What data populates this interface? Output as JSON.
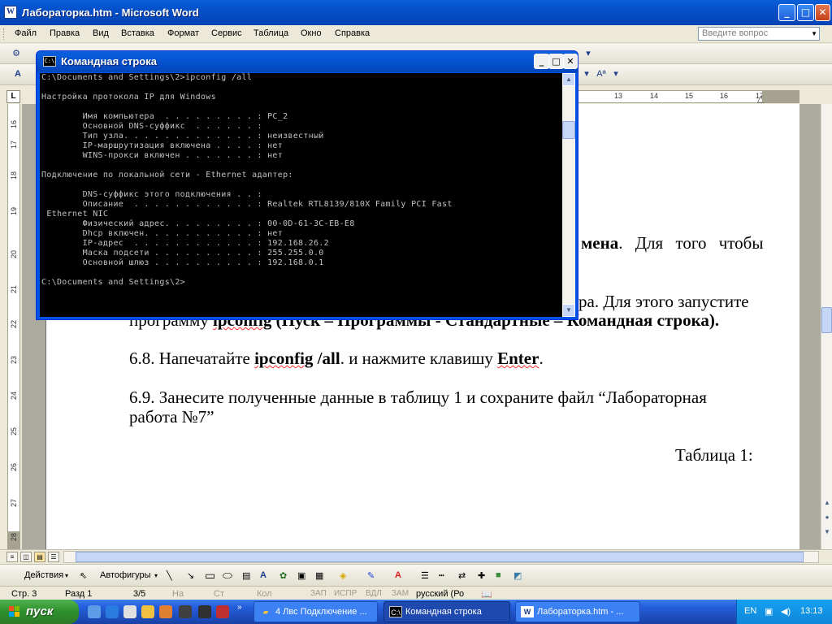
{
  "word": {
    "title": "Лабораторка.htm - Microsoft Word",
    "app_icon": "W",
    "menu": [
      "Файл",
      "Правка",
      "Вид",
      "Вставка",
      "Формат",
      "Сервис",
      "Таблица",
      "Окно",
      "Справка"
    ],
    "ask_placeholder": "Введите вопрос",
    "ruler_numbers": [
      "13",
      "14",
      "15",
      "16",
      "17"
    ],
    "vruler_numbers": [
      "16",
      "17",
      "18",
      "19",
      "20",
      "21",
      "22",
      "23",
      "24",
      "25",
      "26",
      "27",
      "28"
    ],
    "doc": {
      "frag1_bold": "мена",
      "frag1_rest": ". Для того чтобы",
      "frag2": "ра. Для этого запустите",
      "frag3_a": "программу ",
      "frag3_b": "ipconfig",
      "frag3_c": " (Пуск – Программы - Стандартные – ",
      "frag3_d": "Командная строка).",
      "p68_a": "6.8. Напечатайте ",
      "p68_b": "ipconfig",
      "p68_c": " /all",
      "p68_d": ". и нажмите клавишу ",
      "p68_e": "Enter",
      "p68_f": ".",
      "p69_line1": "6.9. Занесите полученные данные в таблицу 1 и сохраните файл “Лабораторная",
      "p69_line2": "работа №7”",
      "table_caption": "Таблица 1:"
    },
    "draw_toolbar": {
      "actions": "Действия",
      "autoshapes": "Автофигуры"
    },
    "status": {
      "page": "Стр. 3",
      "section": "Разд 1",
      "pages": "3/5",
      "at": "На",
      "line": "Ст",
      "col": "Кол",
      "rec": "ЗАП",
      "trk": "ИСПР",
      "ext": "ВДЛ",
      "ovr": "ЗАМ",
      "language": "русский (Ро"
    }
  },
  "cmd": {
    "title": "Командная строка",
    "icon_text": "C:\\",
    "lines": [
      "C:\\Documents and Settings\\2>ipconfig /all",
      "",
      "Настройка протокола IP для Windows",
      "",
      "        Имя компьютера  . . . . . . . . . : PC_2",
      "        Основной DNS-суффикс  . . . . . . :",
      "        Тип узла. . . . . . . . . . . . . : неизвестный",
      "        IP-маршрутизация включена . . . . : нет",
      "        WINS-прокси включен . . . . . . . : нет",
      "",
      "Подключение по локальной сети - Ethernet адаптер:",
      "",
      "        DNS-суффикс этого подключения . . :",
      "        Описание  . . . . . . . . . . . . : Realtek RTL8139/810X Family PCI Fast",
      " Ethernet NIC",
      "        Физический адрес. . . . . . . . . : 00-0D-61-3C-EB-E8",
      "        Dhcp включен. . . . . . . . . . . : нет",
      "        IP-адрес  . . . . . . . . . . . . : 192.168.26.2",
      "        Маска подсети . . . . . . . . . . : 255.255.0.0",
      "        Основной шлюз . . . . . . . . . . : 192.168.0.1",
      "",
      "C:\\Documents and Settings\\2>"
    ]
  },
  "taskbar": {
    "start": "пуск",
    "tasks": [
      "4 Лвс Подключение ...",
      "Командная строка",
      "Лабораторка.htm - ..."
    ],
    "language": "EN",
    "clock": "13:13"
  },
  "colors": {
    "xp_blue": "#0054E3",
    "start_green": "#2D8F2C",
    "console_bg": "#000000",
    "console_fg": "#C0C0C0"
  }
}
